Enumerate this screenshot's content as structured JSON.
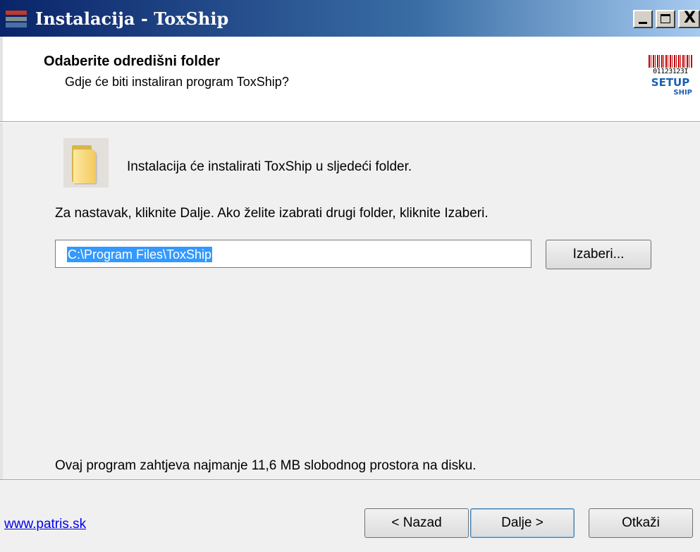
{
  "window": {
    "title": "Instalacija - ToxShip",
    "minimize_label": "_",
    "close_label": "X"
  },
  "header": {
    "title": "Odaberite odredišni folder",
    "subtitle": "Gdje će biti instaliran program ToxShip?",
    "logo": {
      "barcode_digits": "01123123I",
      "word": "SETUP",
      "sub": "SHIP"
    }
  },
  "content": {
    "intro": "Instalacija će instalirati ToxShip u sljedeći folder.",
    "instructions": "Za nastavak, kliknite Dalje. Ako želite izabrati drugi folder, kliknite Izaberi.",
    "path_value": "C:\\Program Files\\ToxShip",
    "browse_label": "Izaberi...",
    "space_required": "Ovaj program zahtjeva najmanje 11,6 MB slobodnog prostora na disku."
  },
  "footer": {
    "link": "www.patris.sk",
    "back_label": "< Nazad",
    "next_label": "Dalje >",
    "cancel_label": "Otkaži"
  },
  "colors": {
    "selection": "#3399ff",
    "link": "#0000ee",
    "titlebar_start": "#0a246a"
  },
  "icons": [
    "app-icon",
    "minimize-icon",
    "maximize-icon",
    "close-icon",
    "setup-logo",
    "folder-icon"
  ]
}
